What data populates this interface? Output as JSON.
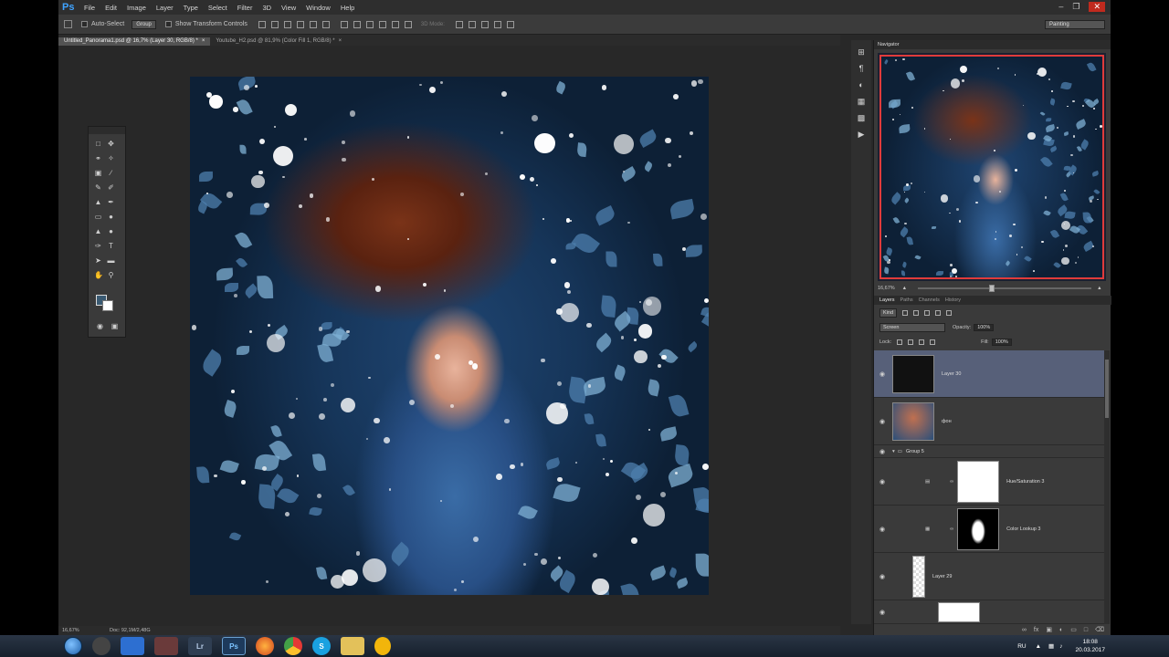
{
  "app": {
    "logo": "Ps"
  },
  "menu": [
    "File",
    "Edit",
    "Image",
    "Layer",
    "Type",
    "Select",
    "Filter",
    "3D",
    "View",
    "Window",
    "Help"
  ],
  "options": {
    "auto_select_label": "Auto-Select",
    "auto_select_value": "Group",
    "transform_label": "Show Transform Controls",
    "mode_3d_label": "3D Mode:",
    "workspace": "Painting"
  },
  "tabs": [
    {
      "label": "Untitled_Panorama1.psd @ 16,7% (Layer 30, RGB/8) *",
      "close": "×"
    },
    {
      "label": "Youtube_H2.psd @ 81,9% (Color Fill 1, RGB/8) *",
      "close": "×"
    }
  ],
  "status": {
    "zoom": "16,67%",
    "doc": "Doc: 92,1M/2,48G"
  },
  "navigator": {
    "title": "Navigator",
    "zoom": "16,67%"
  },
  "layers_panel": {
    "tabs": [
      "Layers",
      "Paths",
      "Channels",
      "History"
    ],
    "filter_kind": "Kind",
    "blend_mode": "Screen",
    "opacity_label": "Opacity:",
    "opacity_value": "100%",
    "lock_label": "Lock:",
    "fill_label": "Fill:",
    "fill_value": "100%",
    "layers": [
      {
        "name": "Layer 30",
        "selected": true
      },
      {
        "name": "фон",
        "selected": false
      },
      {
        "name": "Group 5",
        "selected": false
      },
      {
        "name": "Hue/Saturation 3",
        "selected": false
      },
      {
        "name": "Color Lookup 3",
        "selected": false
      },
      {
        "name": "Layer 29",
        "selected": false
      }
    ]
  },
  "taskbar": {
    "lang": "RU",
    "time": "18:08",
    "date": "20.03.2017",
    "apps": [
      "Lr",
      "Ps"
    ]
  },
  "colors": {
    "selection": "#576079",
    "navigator_frame": "#e03b3b",
    "ps_blue": "#3fa3ff"
  }
}
